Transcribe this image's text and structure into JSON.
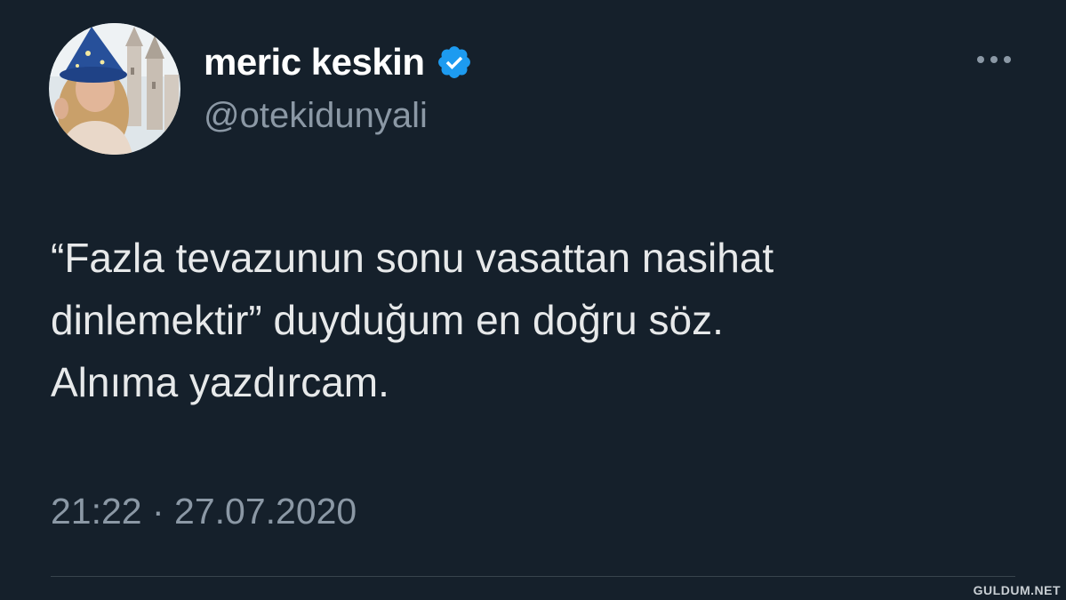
{
  "author": {
    "display_name": "meric keskin",
    "handle": "@otekidunyali",
    "verified": true,
    "avatar_icon": "profile-photo"
  },
  "tweet": {
    "text_lines": [
      "“Fazla tevazunun sonu vasattan nasihat",
      "dinlemektir” duyduğum en doğru söz.",
      "Alnıma yazdırcam."
    ],
    "timestamp": "21:22 · 27.07.2020"
  },
  "actions": {
    "more_icon": "more-horizontal-icon"
  },
  "watermark": "GULDUM.NET",
  "colors": {
    "background": "#15202b",
    "primary_text": "#e7e9ea",
    "secondary_text": "#8b98a5",
    "verified_blue": "#1d9bf0",
    "divider": "#38444d"
  }
}
